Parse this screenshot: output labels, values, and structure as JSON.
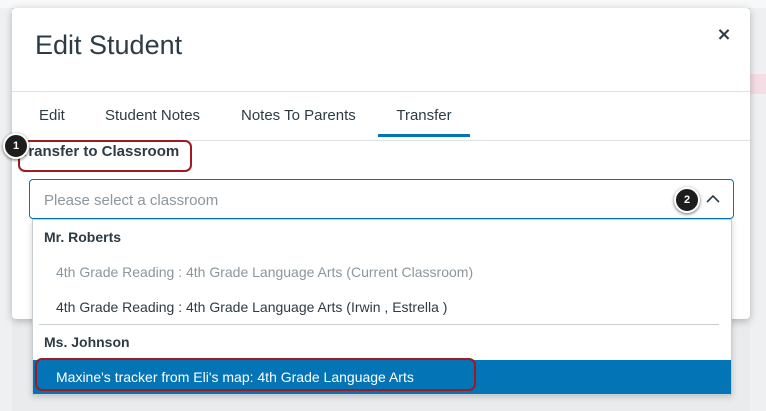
{
  "modal": {
    "title": "Edit Student",
    "close_symbol": "×"
  },
  "tabs": [
    {
      "label": "Edit",
      "active": false
    },
    {
      "label": "Student Notes",
      "active": false
    },
    {
      "label": "Notes To Parents",
      "active": false
    },
    {
      "label": "Transfer",
      "active": true
    }
  ],
  "transfer": {
    "label": "Transfer to Classroom",
    "placeholder": "Please select a classroom",
    "dropdown_open": true,
    "groups": [
      {
        "name": "Mr. Roberts",
        "options": [
          {
            "label": "4th Grade Reading : 4th Grade Language Arts (Current Classroom)",
            "disabled": true
          },
          {
            "label": "4th Grade Reading : 4th Grade Language Arts (Irwin , Estrella )",
            "disabled": false
          }
        ]
      },
      {
        "name": "Ms. Johnson",
        "options": [
          {
            "label": "Maxine's tracker from Eli's map: 4th Grade Language Arts",
            "highlighted": true
          }
        ]
      }
    ]
  },
  "callouts": [
    "1",
    "2"
  ],
  "colors": {
    "accent": "#0374b5",
    "callout_outline": "#a11a1e",
    "text": "#2d3b45",
    "muted": "#8b969e"
  },
  "icons": {
    "close": "close-icon",
    "chevron": "chevron-up-icon"
  }
}
